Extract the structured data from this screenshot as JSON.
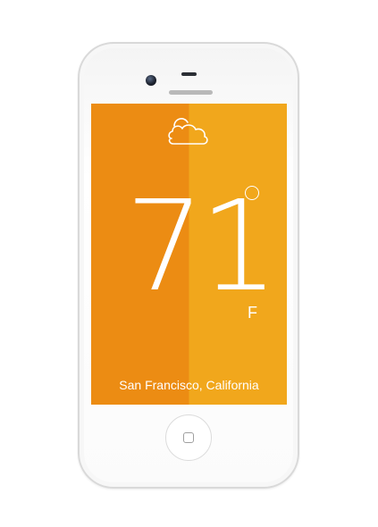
{
  "weather": {
    "temperature": "71",
    "unit": "F",
    "location": "San Francisco, California",
    "condition_icon": "partly-cloudy-icon"
  },
  "device": {
    "model_icon": "smartphone-frame",
    "home_button_icon": "home-square-icon"
  },
  "colors": {
    "screen_left": "#ec8c13",
    "screen_right": "#f1a71c",
    "text": "#ffffff"
  }
}
